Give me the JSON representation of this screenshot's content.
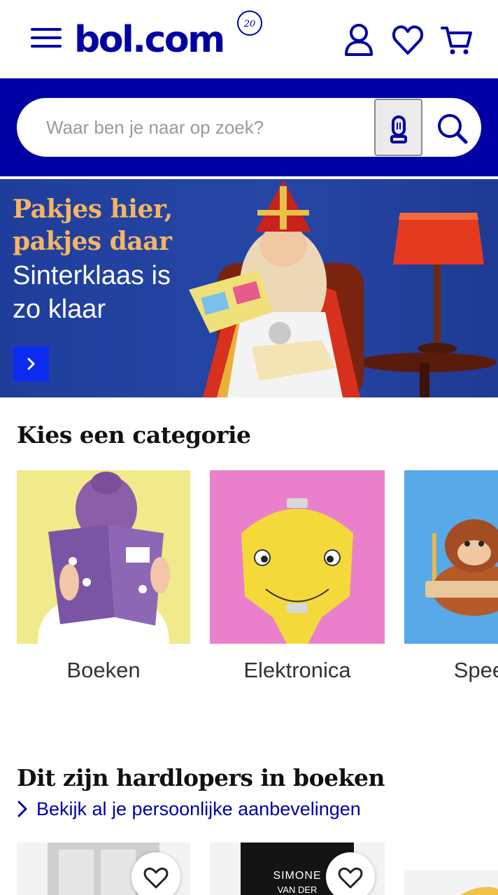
{
  "header": {
    "logo_text": "bol.com",
    "menu_icon": "hamburger-menu-icon",
    "account_icon": "user-icon",
    "wishlist_icon": "heart-icon",
    "cart_icon": "cart-icon",
    "brand_color": "#0000a4"
  },
  "search": {
    "placeholder": "Waar ben je naar op zoek?",
    "value": "",
    "mic_icon": "microphone-icon",
    "search_icon": "search-icon"
  },
  "banner": {
    "title": "Pakjes hier, pakjes daar",
    "subtitle": "Sinterklaas is zo klaar",
    "cta_icon": "chevron-right-icon",
    "title_color": "#f5b563",
    "cta_color": "#0b2cf0"
  },
  "categories": {
    "heading": "Kies een categorie",
    "items": [
      {
        "label": "Boeken",
        "bg": "#f1ea8a"
      },
      {
        "label": "Elektronica",
        "bg": "#ea80cc"
      },
      {
        "label": "Speelg",
        "bg": "#57a9e8"
      }
    ]
  },
  "recommendations": {
    "heading": "Dit zijn hardlopers in boeken",
    "link_label": "Bekijk al je persoonlijke aanbevelingen",
    "link_icon": "chevron-right-icon",
    "products": [
      {
        "cover_text": "",
        "wishlist_icon": "heart-outline-icon"
      },
      {
        "cover_text": "SIMONE\nVAN DER",
        "wishlist_icon": "heart-outline-icon"
      },
      {
        "cover_text": "",
        "wishlist_icon": "heart-outline-icon"
      }
    ]
  }
}
